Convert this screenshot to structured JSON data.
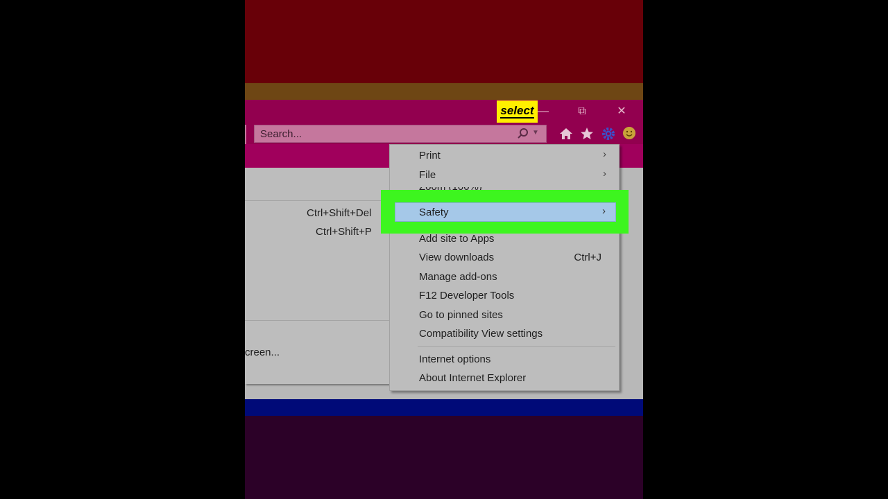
{
  "video_overlay": {
    "badge_text": "select"
  },
  "window_controls": {
    "minimize": "—",
    "restore": "⧉",
    "close": "✕"
  },
  "search": {
    "placeholder": "Search..."
  },
  "toolbar_icons": [
    "home-icon",
    "star-icon",
    "gear-icon",
    "smiley-icon"
  ],
  "left_menu": {
    "item1_shortcut": "Ctrl+Shift+Del",
    "item2_shortcut": "Ctrl+Shift+P",
    "bottom_item_partial": "creen..."
  },
  "tools_menu": {
    "print": {
      "label": "Print",
      "arrow": "›"
    },
    "file": {
      "label": "File",
      "arrow": "›"
    },
    "zoom_partial": "Zoom (100%)",
    "safety": {
      "label": "Safety",
      "arrow": "›"
    },
    "add_site": "Add site to Apps",
    "view_downloads": {
      "label": "View downloads",
      "shortcut": "Ctrl+J"
    },
    "manage_addons": "Manage add-ons",
    "dev_tools": "F12 Developer Tools",
    "pinned_sites": "Go to pinned sites",
    "compat_view": "Compatibility View settings",
    "internet_options": "Internet options",
    "about_ie": "About Internet Explorer"
  },
  "colors": {
    "highlight_green": "#3df51f",
    "badge_yellow": "#ffef00",
    "titlebar_magenta": "#92004f",
    "menu_gray": "#bdbdbd",
    "selected_blue": "#a5c8e8"
  }
}
